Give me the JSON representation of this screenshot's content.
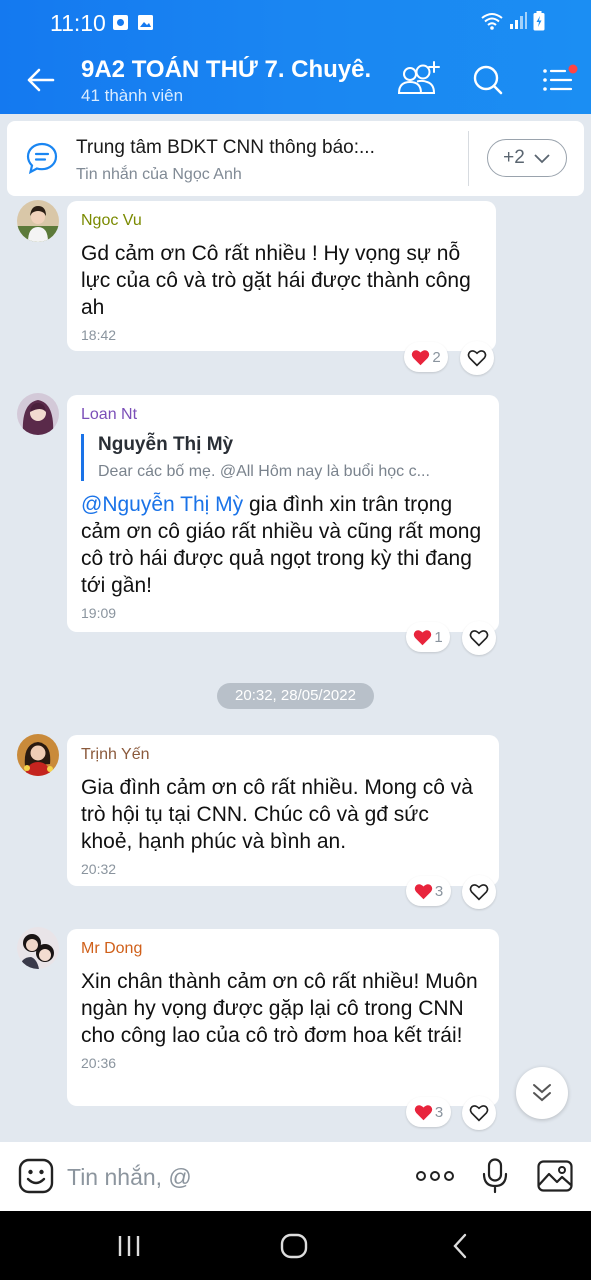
{
  "status_bar": {
    "time": "11:10"
  },
  "header": {
    "title": "9A2 TOÁN THỨ 7. Chuyê...",
    "subtitle": "41 thành viên"
  },
  "pinned": {
    "title": "Trung tâm BDKT CNN thông báo:...",
    "subtitle": "Tin nhắn của Ngọc Anh",
    "more_label": "+2"
  },
  "messages": [
    {
      "sender": "Ngoc Vu",
      "sender_color": "#7a8a00",
      "text": "Gd cảm ơn Cô rất nhiều ! Hy vọng sự nỗ lực của cô và trò gặt hái được thành công ah",
      "time": "18:42",
      "reaction_count": "2"
    },
    {
      "sender": "Loan Nt",
      "sender_color": "#7b4fb8",
      "quote_name": "Nguyễn Thị Mỳ",
      "quote_text": "Dear các bố mẹ. @All  Hôm nay là buổi học c...",
      "mention": "@Nguyễn Thị Mỳ",
      "text": " gia đình xin trân trọng cảm ơn cô giáo rất nhiều và cũng rất mong cô trò hái được quả ngọt trong kỳ thi đang tới gần!",
      "time": "19:09",
      "reaction_count": "1"
    },
    {
      "sender": "Trịnh Yến",
      "sender_color": "#8b5a3c",
      "text": "Gia đình cảm ơn cô rất nhiều. Mong cô và trò hội tụ tại CNN. Chúc cô và gđ sức khoẻ, hạnh phúc và bình an.",
      "time": "20:32",
      "reaction_count": "3"
    },
    {
      "sender": "Mr Dong",
      "sender_color": "#d0601a",
      "text": "Xin chân thành cảm ơn cô rất nhiều! Muôn ngàn hy vọng được gặp lại cô trong CNN cho công lao của cô trò đơm hoa kết trái!",
      "time": "20:36",
      "reaction_count": "3"
    }
  ],
  "date_separator": "20:32, 28/05/2022",
  "composer": {
    "placeholder": "Tin nhắn, @"
  },
  "icons": {
    "back": "arrow-left-icon",
    "add_member": "add-member-icon",
    "search": "search-icon",
    "menu": "menu-icon",
    "pinned": "chat-bubble-icon",
    "heart": "heart-icon",
    "like": "heart-outline-icon",
    "scroll_down": "double-chevron-down-icon",
    "emoji": "emoji-icon",
    "more": "more-dots-icon",
    "mic": "microphone-icon",
    "image": "image-icon"
  },
  "colors": {
    "header_blue": "#1a86f2",
    "accent": "#1a73e8",
    "heart": "#e8243c",
    "notification_dot": "#ff4444"
  }
}
